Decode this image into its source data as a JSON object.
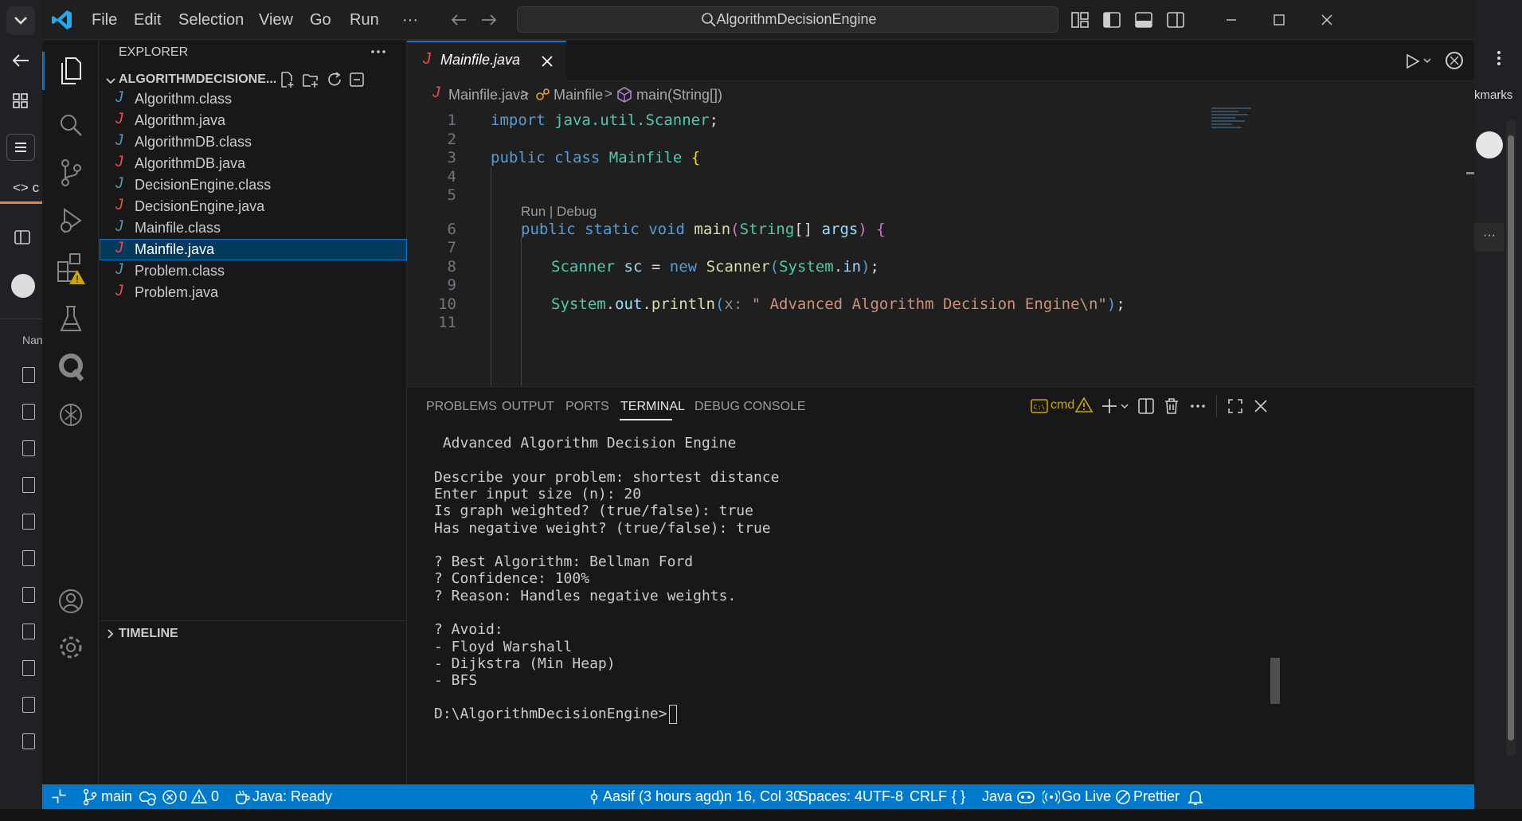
{
  "titlebar": {
    "menu": [
      "File",
      "Edit",
      "Selection",
      "View",
      "Go",
      "Run",
      "···"
    ],
    "search_text": "AlgorithmDecisionEngine"
  },
  "browser_bg": {
    "right_text": "kmarks",
    "left_tab_text": "<> c",
    "left_label": "Nan",
    "right_dots": "···"
  },
  "activitybar": {
    "items": [
      "explorer-icon",
      "search-icon",
      "source-control-icon",
      "run-debug-icon",
      "extensions-icon",
      "testing-icon",
      "quokka-icon",
      "chatgpt-icon"
    ],
    "bottom": [
      "account-icon",
      "manage-icon"
    ]
  },
  "sidebar": {
    "title": "EXPLORER",
    "folder": "ALGORITHMDECISIONE...",
    "files": [
      {
        "name": "Algorithm.class",
        "kind": "class"
      },
      {
        "name": "Algorithm.java",
        "kind": "java"
      },
      {
        "name": "AlgorithmDB.class",
        "kind": "class"
      },
      {
        "name": "AlgorithmDB.java",
        "kind": "java"
      },
      {
        "name": "DecisionEngine.class",
        "kind": "class"
      },
      {
        "name": "DecisionEngine.java",
        "kind": "java"
      },
      {
        "name": "Mainfile.class",
        "kind": "class"
      },
      {
        "name": "Mainfile.java",
        "kind": "java",
        "selected": true
      },
      {
        "name": "Problem.class",
        "kind": "class"
      },
      {
        "name": "Problem.java",
        "kind": "java"
      }
    ],
    "timeline": "TIMELINE"
  },
  "editor": {
    "tab_label": "Mainfile.java",
    "breadcrumb": {
      "file": "Mainfile.java",
      "class": "Mainfile",
      "method": "main(String[])"
    },
    "codelens": "Run | Debug",
    "line_numbers": [
      "1",
      "2",
      "3",
      "4",
      "5",
      "6",
      "7",
      "8",
      "9",
      "10",
      "11"
    ]
  },
  "panel": {
    "tabs": [
      "PROBLEMS",
      "OUTPUT",
      "PORTS",
      "TERMINAL",
      "DEBUG CONSOLE"
    ],
    "active_tab": "TERMINAL",
    "shell": "cmd",
    "terminal_lines": [
      " Advanced Algorithm Decision Engine",
      "",
      "Describe your problem: shortest distance",
      "Enter input size (n): 20",
      "Is graph weighted? (true/false): true",
      "Has negative weight? (true/false): true",
      "",
      "? Best Algorithm: Bellman Ford",
      "? Confidence: 100%",
      "? Reason: Handles negative weights.",
      "",
      "? Avoid:",
      "- Floyd Warshall",
      "- Dijkstra (Min Heap)",
      "- BFS",
      ""
    ],
    "prompt": "D:\\AlgorithmDecisionEngine>"
  },
  "statusbar": {
    "branch": "main",
    "errors": "0",
    "warnings": "0",
    "java_status": "Java: Ready",
    "blame": "Aasif (3 hours ago)",
    "cursor_pos": "Ln 16, Col 30",
    "spaces": "Spaces: 4",
    "encoding": "UTF-8",
    "eol": "CRLF",
    "language_braces": "{ }",
    "language": "Java",
    "go_live": "Go Live",
    "prettier": "Prettier"
  },
  "colors": {
    "accent": "#0078d4",
    "statusbar": "#007acc",
    "java_icon": "#f14c4c",
    "class_icon": "#519aba",
    "warning": "#cca700"
  }
}
